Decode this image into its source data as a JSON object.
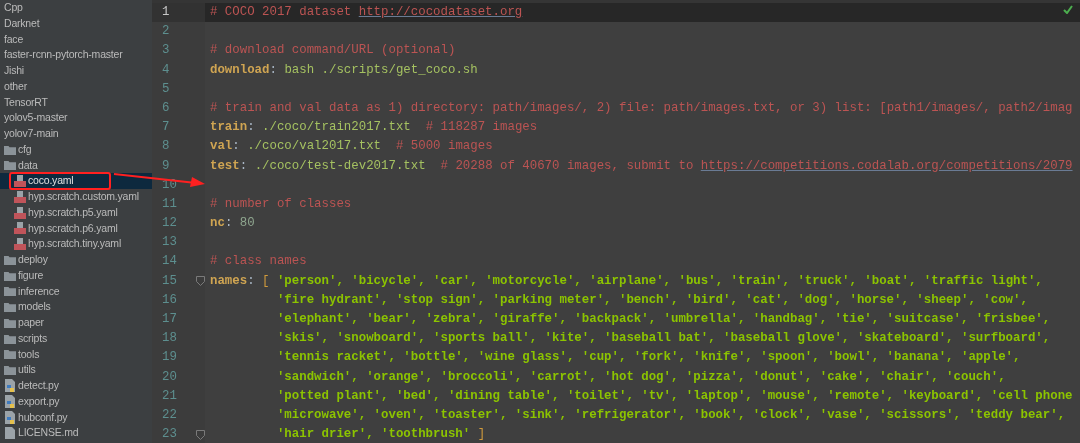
{
  "project_tree": [
    {
      "name": "Cpp",
      "selected": false
    },
    {
      "name": "Darknet",
      "selected": false
    },
    {
      "name": "face",
      "selected": false
    },
    {
      "name": "faster-rcnn-pytorch-master",
      "selected": false
    },
    {
      "name": "Jishi",
      "selected": false
    },
    {
      "name": "other",
      "selected": false
    },
    {
      "name": "TensorRT",
      "selected": false
    },
    {
      "name": "yolov5-master",
      "selected": false
    },
    {
      "name": "yolov7-main",
      "selected": false,
      "children": [
        {
          "name": "cfg",
          "kind": "folder",
          "selected": false
        },
        {
          "name": "data",
          "kind": "folder",
          "selected": false,
          "children": [
            {
              "name": "coco.yaml",
              "kind": "yaml",
              "selected": true
            },
            {
              "name": "hyp.scratch.custom.yaml",
              "kind": "yaml",
              "selected": false
            },
            {
              "name": "hyp.scratch.p5.yaml",
              "kind": "yaml",
              "selected": false
            },
            {
              "name": "hyp.scratch.p6.yaml",
              "kind": "yaml",
              "selected": false
            },
            {
              "name": "hyp.scratch.tiny.yaml",
              "kind": "yaml",
              "selected": false
            }
          ]
        },
        {
          "name": "deploy",
          "kind": "folder",
          "selected": false
        },
        {
          "name": "figure",
          "kind": "folder",
          "selected": false
        },
        {
          "name": "inference",
          "kind": "folder",
          "selected": false
        },
        {
          "name": "models",
          "kind": "folder",
          "selected": false
        },
        {
          "name": "paper",
          "kind": "folder",
          "selected": false
        },
        {
          "name": "scripts",
          "kind": "folder",
          "selected": false
        },
        {
          "name": "tools",
          "kind": "folder",
          "selected": false
        },
        {
          "name": "utils",
          "kind": "folder",
          "selected": false
        },
        {
          "name": "detect.py",
          "kind": "python",
          "selected": false
        },
        {
          "name": "export.py",
          "kind": "python",
          "selected": false
        },
        {
          "name": "hubconf.py",
          "kind": "python",
          "selected": false
        },
        {
          "name": "LICENSE.md",
          "kind": "markdown",
          "selected": false
        }
      ]
    }
  ],
  "editor": {
    "status_ok": true,
    "lines": [
      {
        "number": "1",
        "current": true,
        "segments": [
          {
            "kind": "comment",
            "text": "# COCO 2017 dataset "
          },
          {
            "kind": "link",
            "text": "http://cocodataset.org"
          }
        ]
      },
      {
        "number": "2",
        "current": false
      },
      {
        "number": "3",
        "current": false,
        "segments": [
          {
            "kind": "comment",
            "text": "# download command/URL (optional)"
          }
        ]
      },
      {
        "number": "4",
        "current": false,
        "segments": [
          {
            "kind": "key",
            "text": "download"
          },
          {
            "kind": "punct",
            "text": ": "
          },
          {
            "kind": "value",
            "text": "bash ./scripts/get_coco.sh"
          }
        ]
      },
      {
        "number": "5",
        "current": false
      },
      {
        "number": "6",
        "current": false,
        "segments": [
          {
            "kind": "comment",
            "text": "# train and val data as 1) directory: path/images/, 2) file: path/images.txt, or 3) list: [path1/images/, path2/imag"
          }
        ]
      },
      {
        "number": "7",
        "current": false,
        "segments": [
          {
            "kind": "key",
            "text": "train"
          },
          {
            "kind": "punct",
            "text": ": "
          },
          {
            "kind": "value",
            "text": "./coco/train2017.txt  "
          },
          {
            "kind": "comment",
            "text": "# 118287 images"
          }
        ]
      },
      {
        "number": "8",
        "current": false,
        "segments": [
          {
            "kind": "key",
            "text": "val"
          },
          {
            "kind": "punct",
            "text": ": "
          },
          {
            "kind": "value",
            "text": "./coco/val2017.txt  "
          },
          {
            "kind": "comment",
            "text": "# 5000 images"
          }
        ]
      },
      {
        "number": "9",
        "current": false,
        "segments": [
          {
            "kind": "key",
            "text": "test"
          },
          {
            "kind": "punct",
            "text": ": "
          },
          {
            "kind": "value",
            "text": "./coco/test-dev2017.txt  "
          },
          {
            "kind": "comment",
            "text": "# 20288 of 40670 images, submit to "
          },
          {
            "kind": "link",
            "text": "https://competitions.codalab.org/competitions/2079"
          }
        ]
      },
      {
        "number": "10",
        "current": false
      },
      {
        "number": "11",
        "current": false,
        "segments": [
          {
            "kind": "comment",
            "text": "# number of classes"
          }
        ]
      },
      {
        "number": "12",
        "current": false,
        "segments": [
          {
            "kind": "key",
            "text": "nc"
          },
          {
            "kind": "punct",
            "text": ": "
          },
          {
            "kind": "number",
            "text": "80"
          }
        ]
      },
      {
        "number": "13",
        "current": false
      },
      {
        "number": "14",
        "current": false,
        "segments": [
          {
            "kind": "comment",
            "text": "# class names"
          }
        ]
      },
      {
        "number": "15",
        "current": false,
        "fold": true,
        "segments": [
          {
            "kind": "key",
            "text": "names"
          },
          {
            "kind": "punct",
            "text": ": "
          },
          {
            "kind": "bracket",
            "text": "[ "
          },
          {
            "kind": "string",
            "text": "'person', 'bicycle', 'car', 'motorcycle', 'airplane', 'bus', 'train', 'truck', 'boat', 'traffic light',"
          }
        ]
      },
      {
        "number": "16",
        "current": false,
        "continuation": true,
        "segments": [
          {
            "kind": "string",
            "text": "'fire hydrant', 'stop sign', 'parking meter', 'bench', 'bird', 'cat', 'dog', 'horse', 'sheep', 'cow',"
          }
        ]
      },
      {
        "number": "17",
        "current": false,
        "continuation": true,
        "segments": [
          {
            "kind": "string",
            "text": "'elephant', 'bear', 'zebra', 'giraffe', 'backpack', 'umbrella', 'handbag', 'tie', 'suitcase', 'frisbee',"
          }
        ]
      },
      {
        "number": "18",
        "current": false,
        "continuation": true,
        "segments": [
          {
            "kind": "string",
            "text": "'skis', 'snowboard', 'sports ball', 'kite', 'baseball bat', 'baseball glove', 'skateboard', 'surfboard',"
          }
        ]
      },
      {
        "number": "19",
        "current": false,
        "continuation": true,
        "segments": [
          {
            "kind": "string",
            "text": "'tennis racket', 'bottle', 'wine glass', 'cup', 'fork', 'knife', 'spoon', 'bowl', 'banana', 'apple',"
          }
        ]
      },
      {
        "number": "20",
        "current": false,
        "continuation": true,
        "segments": [
          {
            "kind": "string",
            "text": "'sandwich', 'orange', 'broccoli', 'carrot', 'hot dog', 'pizza', 'donut', 'cake', 'chair', 'couch',"
          }
        ]
      },
      {
        "number": "21",
        "current": false,
        "continuation": true,
        "segments": [
          {
            "kind": "string",
            "text": "'potted plant', 'bed', 'dining table', 'toilet', 'tv', 'laptop', 'mouse', 'remote', 'keyboard', 'cell phone"
          }
        ]
      },
      {
        "number": "22",
        "current": false,
        "continuation": true,
        "segments": [
          {
            "kind": "string",
            "text": "'microwave', 'oven', 'toaster', 'sink', 'refrigerator', 'book', 'clock', 'vase', 'scissors', 'teddy bear',"
          }
        ]
      },
      {
        "number": "23",
        "current": false,
        "continuation": true,
        "fold": true,
        "segments": [
          {
            "kind": "string",
            "text": "'hair drier', 'toothbrush' "
          },
          {
            "kind": "bracket",
            "text": "]"
          }
        ]
      }
    ]
  }
}
